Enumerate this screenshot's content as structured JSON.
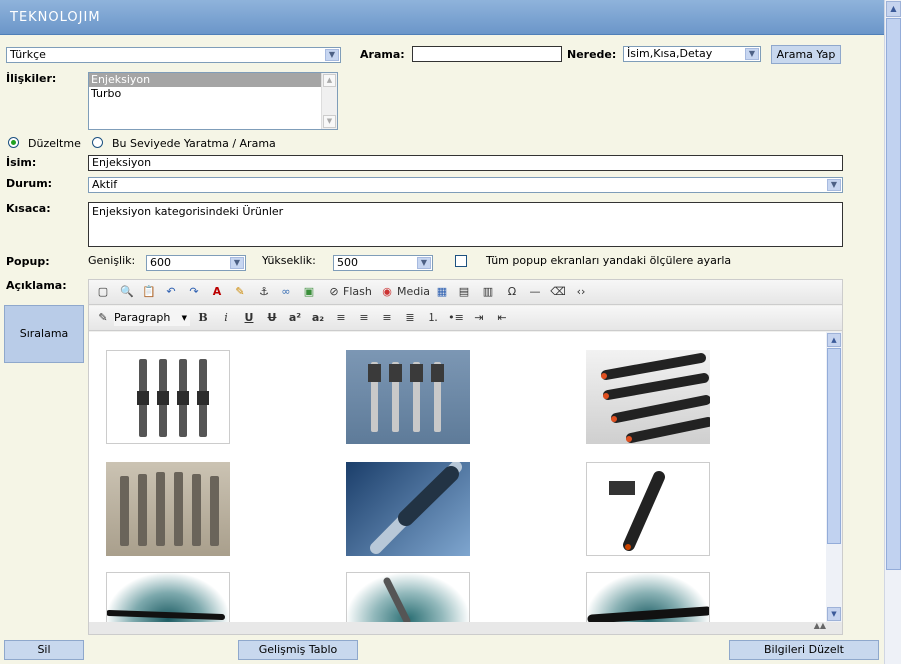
{
  "app": {
    "logo_text": "TEKNOLOJIM"
  },
  "language": {
    "selected": "Türkçe"
  },
  "search": {
    "label": "Arama:",
    "value": "",
    "where_label": "Nerede:",
    "where_selected": "İsim,Kısa,Detay",
    "button": "Arama Yap"
  },
  "relations": {
    "label": "İlişkiler:",
    "items": [
      "Enjeksiyon",
      "Turbo"
    ],
    "selected_index": 0
  },
  "mode": {
    "edit_label": "Düzeltme",
    "create_label": "Bu Seviyede Yaratma / Arama",
    "selected": "edit"
  },
  "name": {
    "label": "İsim:",
    "value": "Enjeksiyon"
  },
  "status": {
    "label": "Durum:",
    "selected": "Aktif"
  },
  "short": {
    "label": "Kısaca:",
    "value": "Enjeksiyon kategorisindeki Ürünler"
  },
  "popup": {
    "label": "Popup:",
    "width_label": "Genişlik:",
    "width_value": "600",
    "height_label": "Yükseklik:",
    "height_value": "500",
    "apply_all_label": "Tüm popup ekranları yandaki ölçülere ayarla",
    "apply_all_checked": false
  },
  "description": {
    "label": "Açıklama:"
  },
  "editor": {
    "flash_label": "Flash",
    "media_label": "Media",
    "format_selected": "Paragraph",
    "images": [
      {
        "name": "injector-image-1"
      },
      {
        "name": "injector-image-2"
      },
      {
        "name": "injector-image-3"
      },
      {
        "name": "injector-image-4"
      },
      {
        "name": "injector-image-5"
      },
      {
        "name": "injector-image-6"
      },
      {
        "name": "injector-image-7"
      },
      {
        "name": "injector-image-8"
      },
      {
        "name": "injector-image-9"
      }
    ]
  },
  "side": {
    "sort_button": "Sıralama"
  },
  "footer": {
    "delete_button": "Sil",
    "advanced_table_button": "Gelişmiş Tablo",
    "update_button": "Bilgileri Düzelt"
  },
  "colors": {
    "header": "#6b96c9",
    "background": "#f5f5e6",
    "button": "#c8d8ee"
  }
}
